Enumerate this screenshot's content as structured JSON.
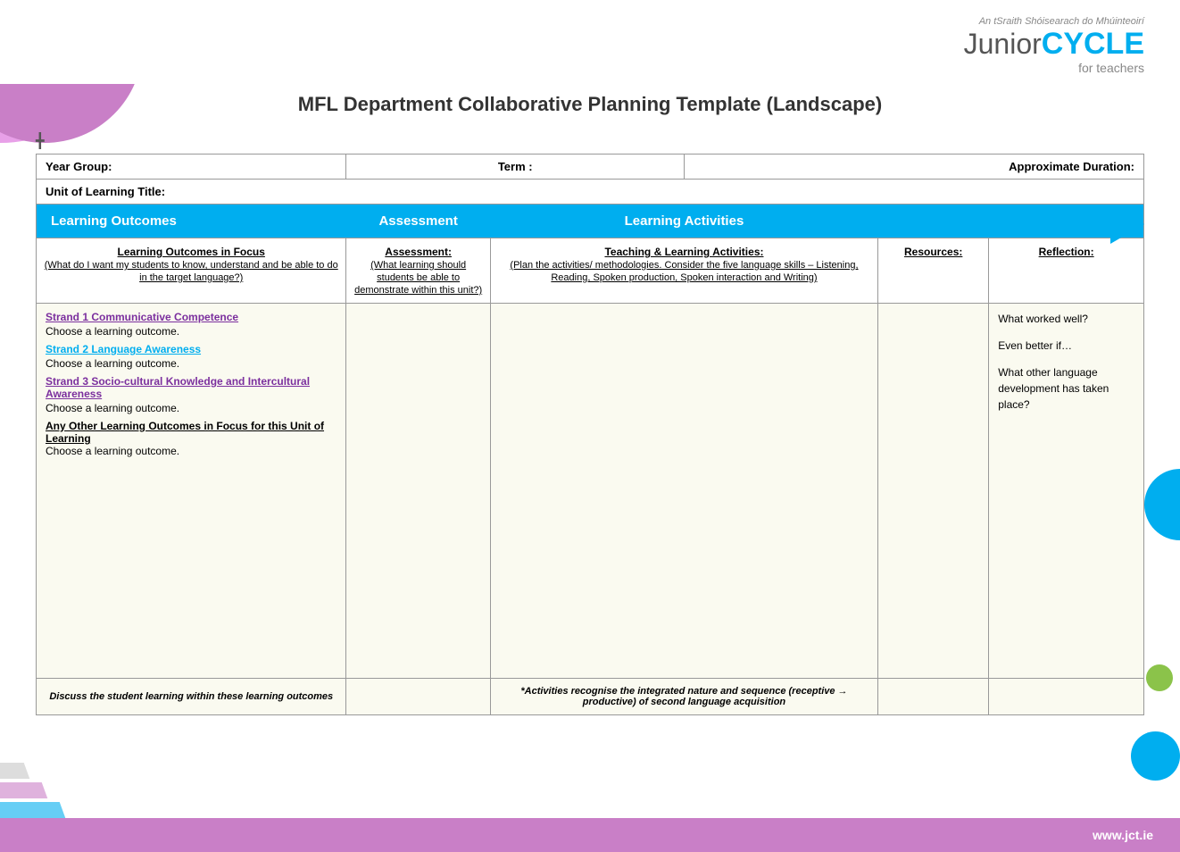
{
  "page": {
    "title": "MFL Department Collaborative Planning Template (Landscape)",
    "background_color": "#fff"
  },
  "header": {
    "logo_subtitle": "An tSraith Shóisearach do Mhúinteoirí",
    "logo_junior": "Junior",
    "logo_cycle": "CYCLE",
    "logo_for_teachers": "for teachers"
  },
  "info_row": {
    "year_group_label": "Year Group:",
    "year_group_value": "",
    "term_label": "Term :",
    "term_value": "",
    "approx_duration_label": "Approximate Duration:",
    "approx_duration_value": "",
    "unit_title_label": "Unit of Learning Title:",
    "unit_title_value": ""
  },
  "blue_header": {
    "learning_outcomes": "Learning Outcomes",
    "assessment": "Assessment",
    "learning_activities": "Learning Activities"
  },
  "col_headers": {
    "learning_outcomes_focus": "Learning Outcomes in Focus",
    "learning_outcomes_sub": "(What do I want my students to know, understand and be able to do in the target language?)",
    "assessment_label": "Assessment:",
    "assessment_sub": "(What learning should students be able to demonstrate within this unit?)",
    "teaching_label": "Teaching & Learning Activities:",
    "teaching_sub": "(Plan the activities/ methodologies. Consider the five language skills – Listening, Reading, Spoken production, Spoken interaction and Writing)",
    "resources_label": "Resources:",
    "reflection_label": "Reflection:"
  },
  "content": {
    "strand1_label": "Strand 1 Communicative Competence",
    "strand1_choose": "Choose a learning outcome.",
    "strand2_label": "Strand 2 Language Awareness",
    "strand2_choose": "Choose a learning outcome.",
    "strand3_label": "Strand 3 Socio-cultural Knowledge and Intercultural Awareness",
    "strand3_choose": "Choose a learning outcome.",
    "any_other_label": "Any Other Learning Outcomes in Focus for this Unit of Learning",
    "any_other_choose": "Choose a learning outcome.",
    "reflection_what_worked": "What worked well?",
    "reflection_even_better": "Even better if…",
    "reflection_what_other": "What other language development has taken place?"
  },
  "footer": {
    "left_text": "Discuss the student learning within these learning outcomes",
    "right_text": "*Activities recognise the integrated nature and sequence (receptive → productive) of second language acquisition"
  },
  "bottom_bar": {
    "url": "www.jct.ie"
  }
}
